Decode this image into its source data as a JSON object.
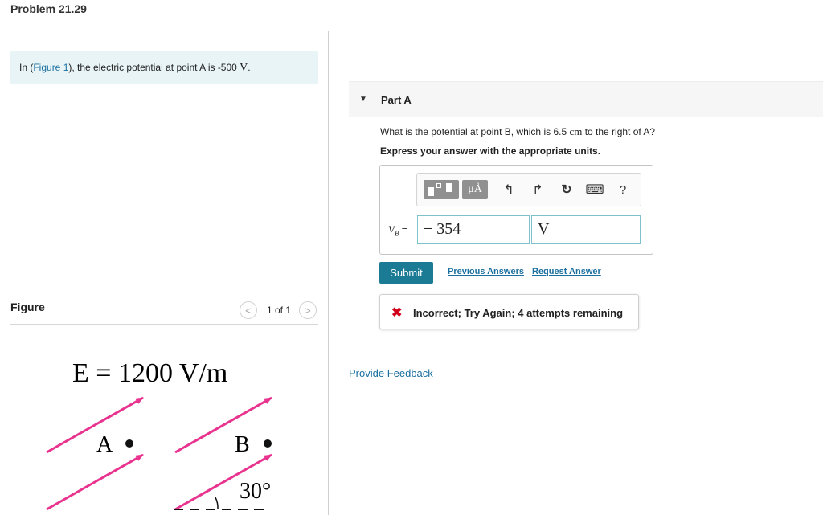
{
  "header": {
    "title": "Problem 21.29"
  },
  "intro": {
    "prefix": "In (",
    "figure_link": "Figure 1",
    "middle": "), the electric potential at point A is -500 ",
    "unit": "V",
    "suffix": "."
  },
  "figure": {
    "label": "Figure",
    "prev_icon": "<",
    "next_icon": ">",
    "page_count": "1 of 1",
    "field_label": "E = 1200 V/m",
    "point_a": "A",
    "point_b": "B",
    "angle": "30°",
    "arrow_color": "#e8338f"
  },
  "part": {
    "caret": "▼",
    "label": "Part A",
    "question_prefix": "What is the potential at point B, which is 6.5 ",
    "question_unit": "cm",
    "question_suffix": " to the right of A?",
    "instruction": "Express your answer with the appropriate units."
  },
  "toolbar": {
    "template_icon": "template-icon",
    "units_label": "μÅ",
    "undo_icon": "↰",
    "redo_icon": "↱",
    "reset_icon": "↻",
    "keyboard_icon": "⌨",
    "help_label": "?"
  },
  "answer": {
    "var_main": "V",
    "var_sub": "B",
    "equals": " =",
    "value": "− 354",
    "unit": "V"
  },
  "actions": {
    "submit": "Submit",
    "previous_answers": "Previous Answers",
    "request_answer": "Request Answer"
  },
  "feedback": {
    "icon": "✖",
    "message": "Incorrect; Try Again; 4 attempts remaining"
  },
  "provide_feedback": "Provide Feedback",
  "colors": {
    "accent": "#1b7a94",
    "link": "#1a6fa0",
    "error": "#d0021b",
    "intro_bg": "#e8f4f6"
  }
}
